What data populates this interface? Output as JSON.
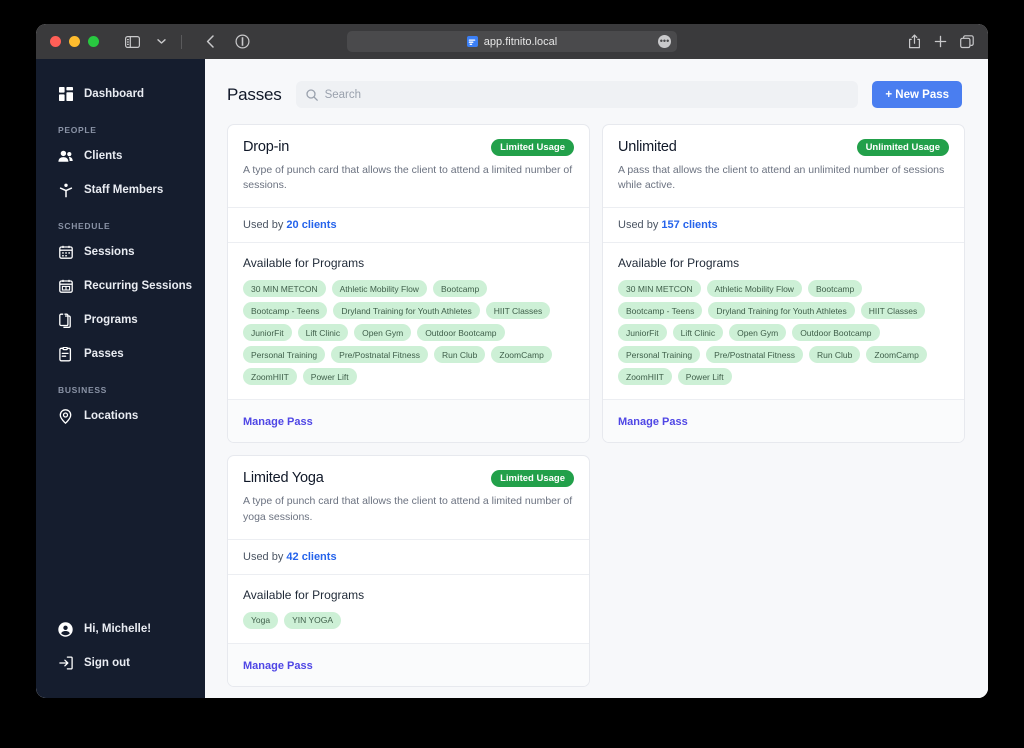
{
  "browser": {
    "url": "app.fitnito.local",
    "favicon": "site-favicon",
    "controls": {
      "close": "close-window",
      "minimize": "minimize-window",
      "maximize": "maximize-window",
      "sidebar_toggle": "sidebar-toggle",
      "tab_overview_chevron": "chevron-down",
      "back": "back-arrow",
      "shield": "privacy-report",
      "url_menu": "url-menu",
      "share": "share-icon",
      "new_tab": "plus-icon",
      "tabs": "tabs-icon"
    }
  },
  "sidebar": {
    "items": [
      {
        "label": "Dashboard",
        "icon": "dashboard-icon"
      }
    ],
    "sections": [
      {
        "label": "PEOPLE",
        "items": [
          {
            "label": "Clients",
            "icon": "users-icon"
          },
          {
            "label": "Staff Members",
            "icon": "staff-icon"
          }
        ]
      },
      {
        "label": "SCHEDULE",
        "items": [
          {
            "label": "Sessions",
            "icon": "calendar-icon"
          },
          {
            "label": "Recurring Sessions",
            "icon": "calendar-repeat-icon"
          },
          {
            "label": "Programs",
            "icon": "clipboard-icon"
          },
          {
            "label": "Passes",
            "icon": "clipboard-list-icon"
          }
        ]
      },
      {
        "label": "BUSINESS",
        "items": [
          {
            "label": "Locations",
            "icon": "map-pin-icon"
          }
        ]
      }
    ],
    "footer": [
      {
        "label": "Hi, Michelle!",
        "icon": "user-circle-icon"
      },
      {
        "label": "Sign out",
        "icon": "sign-out-icon"
      }
    ]
  },
  "header": {
    "title": "Passes",
    "search_placeholder": "Search",
    "search_value": "",
    "new_pass_label": "+ New Pass"
  },
  "labels": {
    "programs_title": "Available for Programs",
    "used_by_prefix": "Used by ",
    "manage_pass": "Manage Pass"
  },
  "colors": {
    "accent_blue": "#4a7ef0",
    "link_blue": "#2563eb",
    "manage_indigo": "#4f46e5",
    "badge_green": "#22a04a",
    "tag_green": "#cdf0d6",
    "sidebar_navy": "#151d2e"
  },
  "passes": [
    {
      "title": "Drop-in",
      "badge": "Limited Usage",
      "description": "A type of punch card that allows the client to attend a limited number of sessions.",
      "used_by_count": "20 clients",
      "programs": [
        "30 MIN METCON",
        "Athletic Mobility Flow",
        "Bootcamp",
        "Bootcamp - Teens",
        "Dryland Training for Youth Athletes",
        "HIIT Classes",
        "JuniorFit",
        "Lift Clinic",
        "Open Gym",
        "Outdoor Bootcamp",
        "Personal Training",
        "Pre/Postnatal Fitness",
        "Run Club",
        "ZoomCamp",
        "ZoomHIIT",
        "Power Lift"
      ]
    },
    {
      "title": "Unlimited",
      "badge": "Unlimited Usage",
      "description": "A pass that allows the client to attend an unlimited number of sessions while active.",
      "used_by_count": "157 clients",
      "programs": [
        "30 MIN METCON",
        "Athletic Mobility Flow",
        "Bootcamp",
        "Bootcamp - Teens",
        "Dryland Training for Youth Athletes",
        "HIIT Classes",
        "JuniorFit",
        "Lift Clinic",
        "Open Gym",
        "Outdoor Bootcamp",
        "Personal Training",
        "Pre/Postnatal Fitness",
        "Run Club",
        "ZoomCamp",
        "ZoomHIIT",
        "Power Lift"
      ]
    },
    {
      "title": "Limited Yoga",
      "badge": "Limited Usage",
      "description": "A type of punch card that allows the client to attend a limited number of yoga sessions.",
      "used_by_count": "42 clients",
      "programs": [
        "Yoga",
        "YIN YOGA"
      ]
    }
  ]
}
